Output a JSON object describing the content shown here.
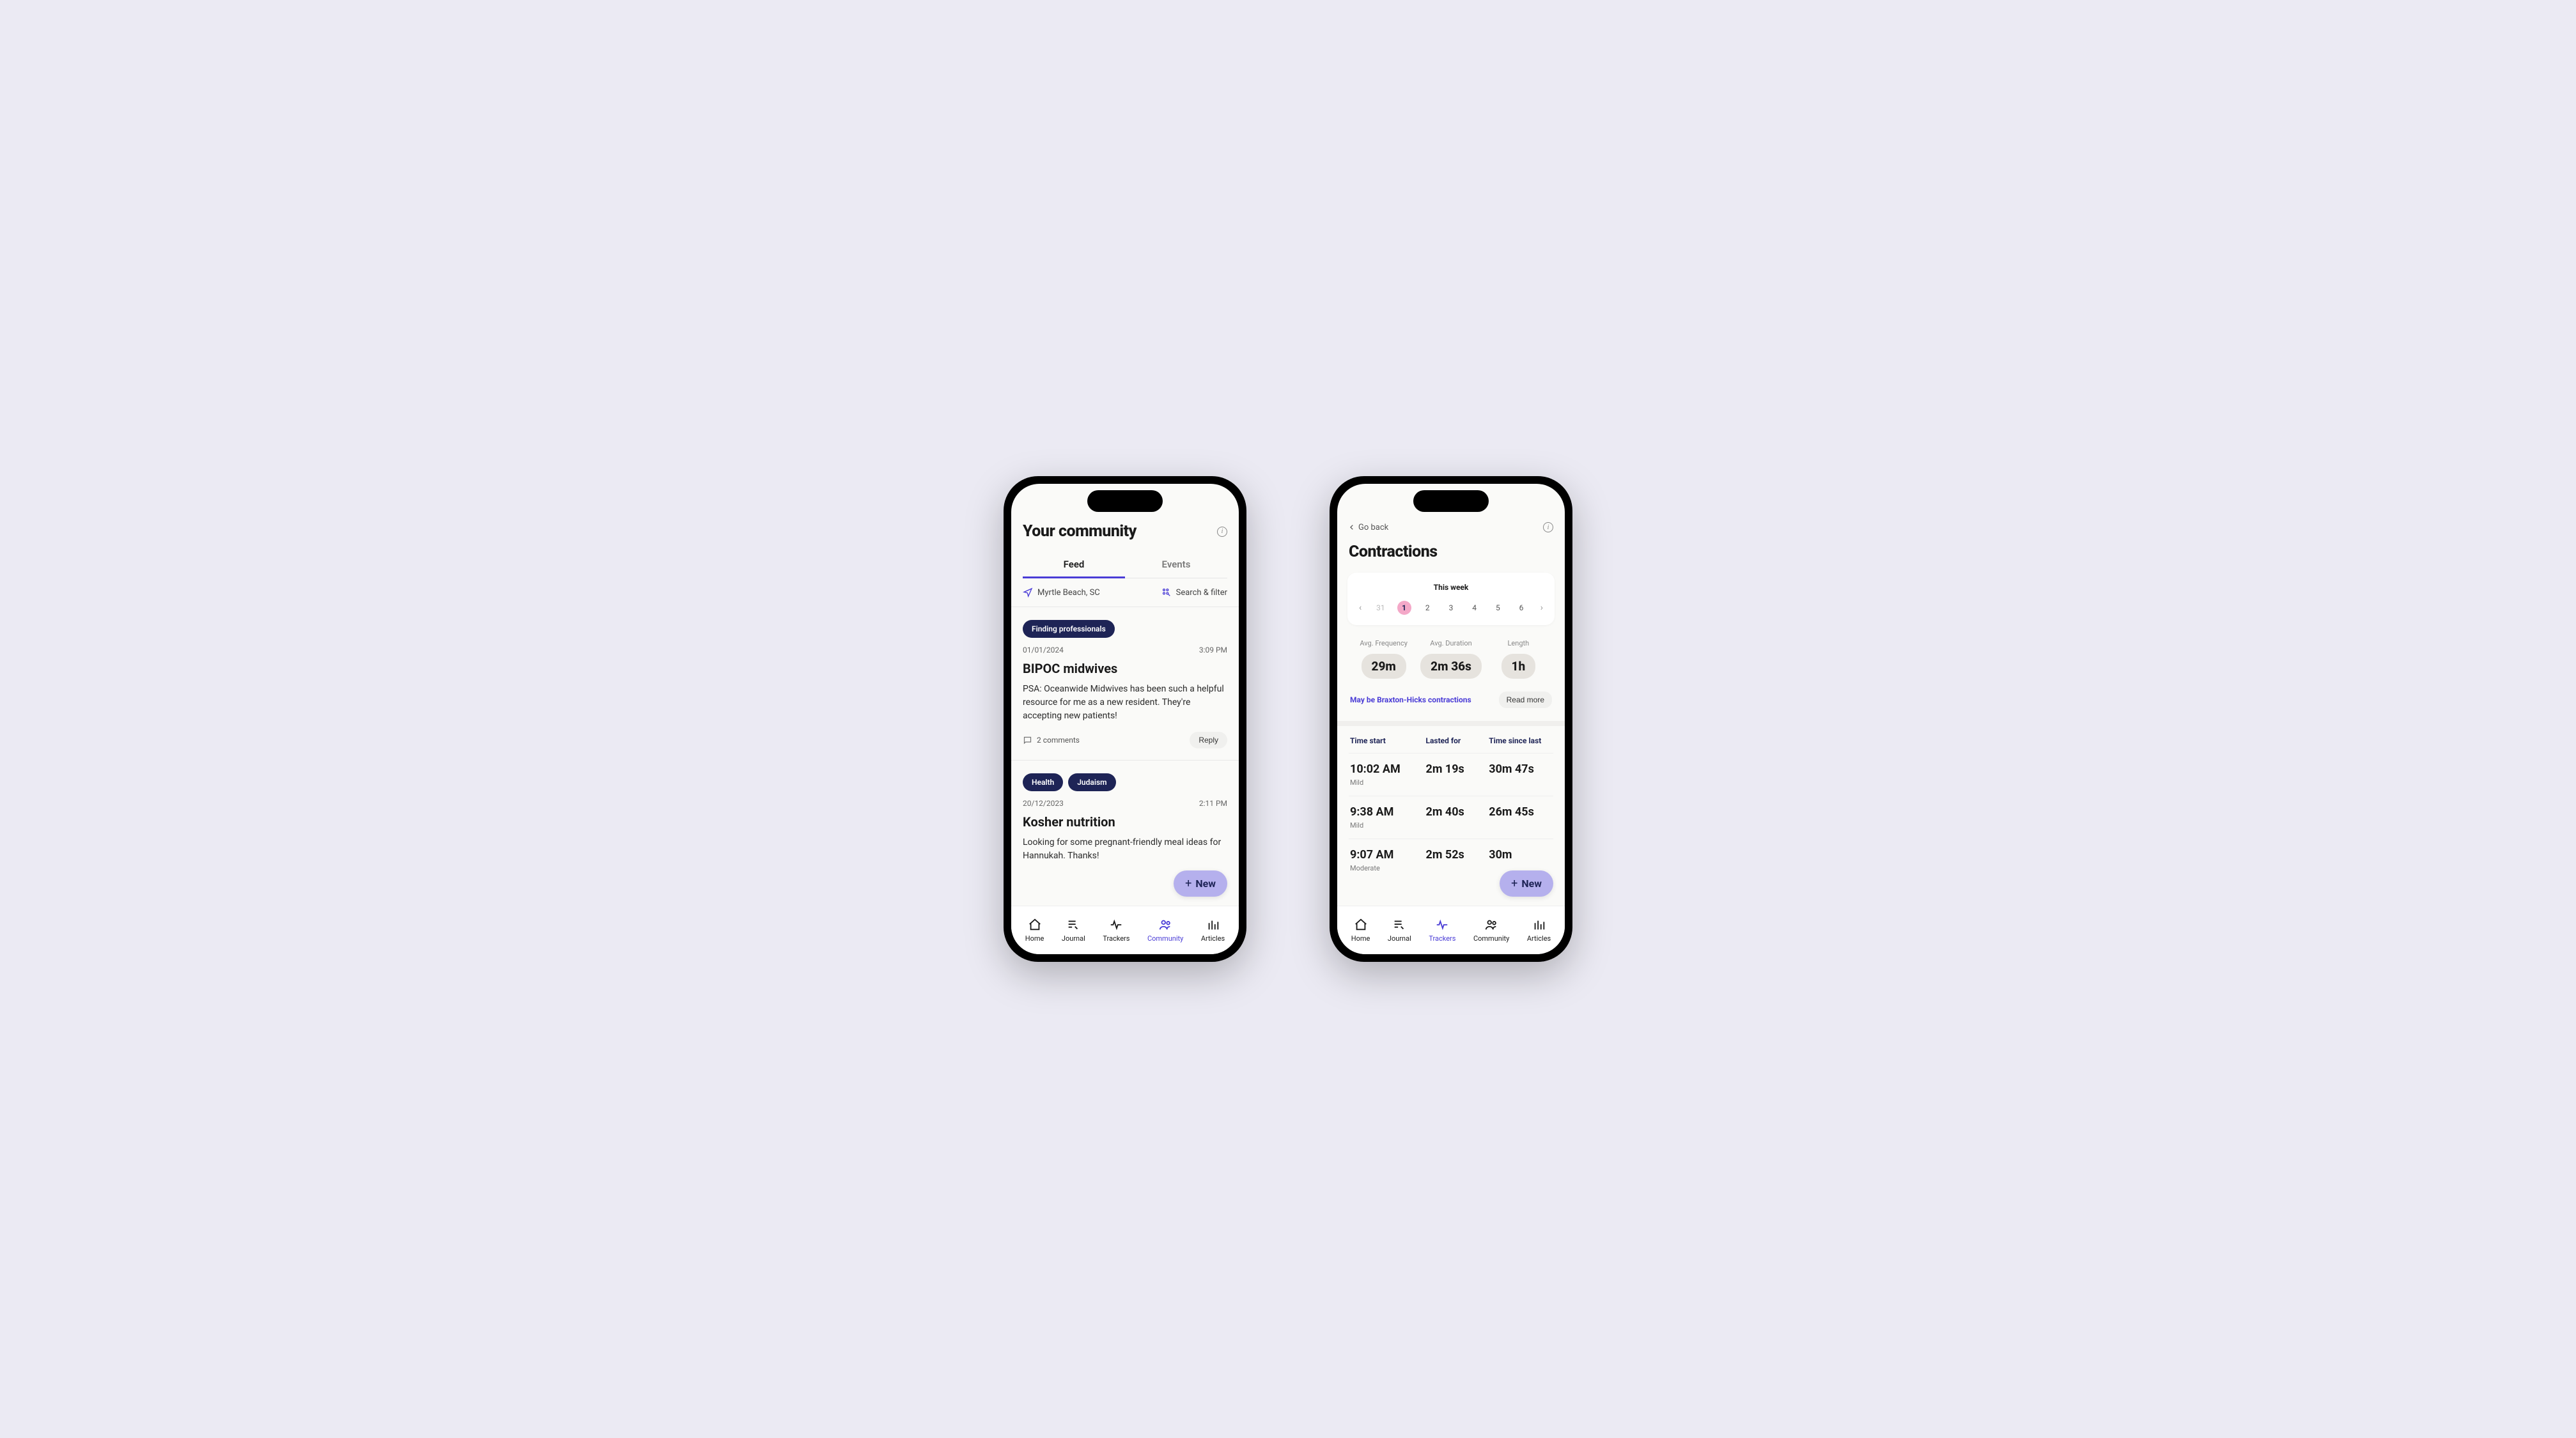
{
  "phone1": {
    "title": "Your community",
    "tabs": [
      {
        "label": "Feed",
        "active": true
      },
      {
        "label": "Events",
        "active": false
      }
    ],
    "location": "Myrtle Beach, SC",
    "search_filter_label": "Search & filter",
    "posts": [
      {
        "tags": [
          "Finding professionals"
        ],
        "date": "01/01/2024",
        "time": "3:09 PM",
        "title": "BIPOC midwives",
        "body": "PSA: Oceanwide Midwives has been such a helpful resource for me as a new resident. They're accepting new patients!",
        "comments": "2 comments",
        "reply_label": "Reply"
      },
      {
        "tags": [
          "Health",
          "Judaism"
        ],
        "date": "20/12/2023",
        "time": "2:11 PM",
        "title": "Kosher nutrition",
        "body": "Looking for some pregnant-friendly meal ideas for Hannukah. Thanks!"
      }
    ],
    "fab_label": "New"
  },
  "phone2": {
    "back_label": "Go back",
    "title": "Contractions",
    "week_label": "This week",
    "days": [
      "31",
      "1",
      "2",
      "3",
      "4",
      "5",
      "6"
    ],
    "selected_day_index": 1,
    "stats": [
      {
        "label": "Avg. Frequency",
        "value": "29m"
      },
      {
        "label": "Avg. Duration",
        "value": "2m 36s"
      },
      {
        "label": "Length",
        "value": "1h"
      }
    ],
    "note": "May be Braxton-Hicks contractions",
    "read_more_label": "Read more",
    "columns": [
      "Time start",
      "Lasted for",
      "Time since last"
    ],
    "rows": [
      {
        "time": "10:02 AM",
        "lasted": "2m 19s",
        "since": "30m 47s",
        "intensity": "Mild"
      },
      {
        "time": "9:38 AM",
        "lasted": "2m 40s",
        "since": "26m 45s",
        "intensity": "Mild"
      },
      {
        "time": "9:07 AM",
        "lasted": "2m 52s",
        "since": "30m",
        "intensity": "Moderate"
      }
    ],
    "fab_label": "New"
  },
  "nav": [
    {
      "label": "Home"
    },
    {
      "label": "Journal"
    },
    {
      "label": "Trackers"
    },
    {
      "label": "Community"
    },
    {
      "label": "Articles"
    }
  ]
}
